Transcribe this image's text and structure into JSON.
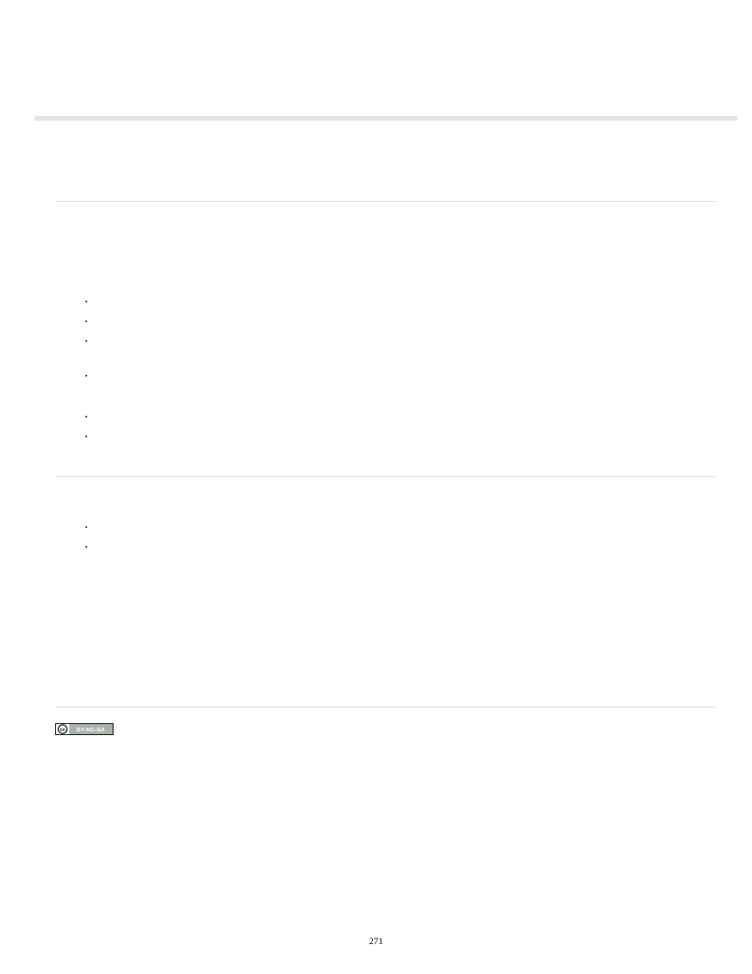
{
  "page_number": "271",
  "cc_badge": {
    "cc_text": "cc",
    "label": "BY-NC-SA"
  },
  "section1": {
    "bullets": [
      "",
      "",
      "",
      "",
      "",
      ""
    ]
  },
  "section2": {
    "bullets": [
      "",
      ""
    ]
  }
}
